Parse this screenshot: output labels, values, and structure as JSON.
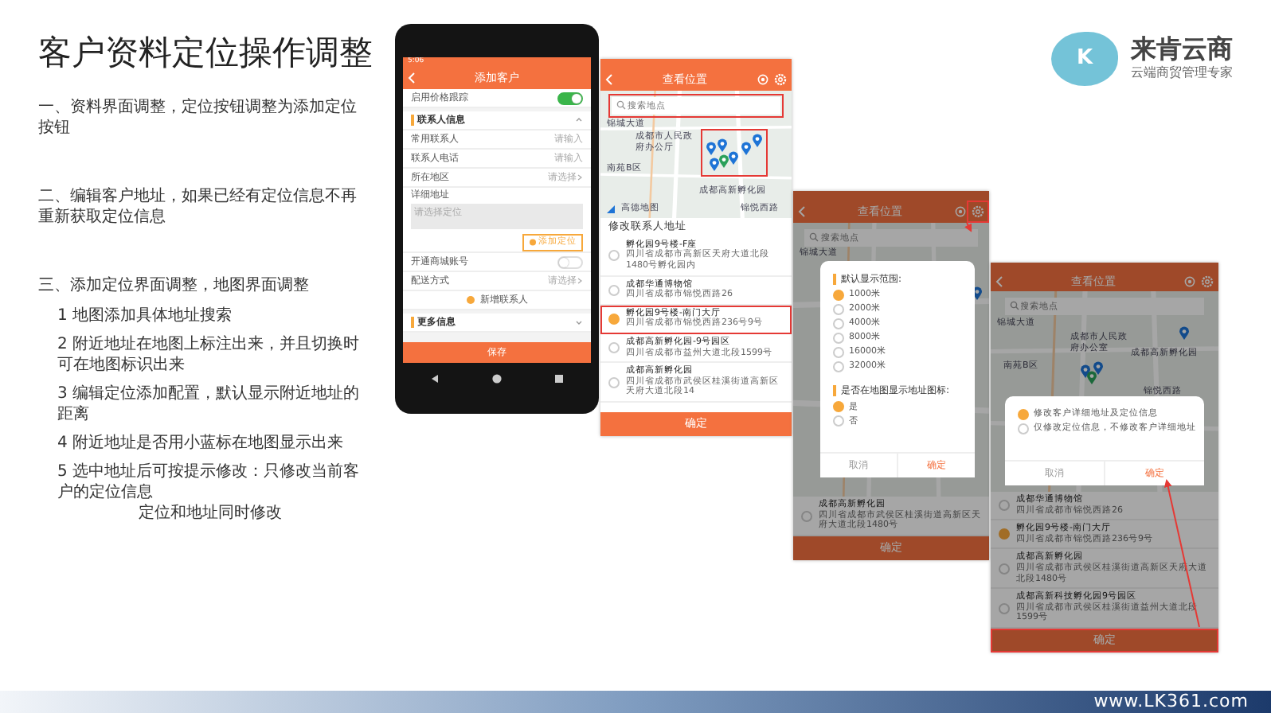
{
  "slide_title": "客户资料定位操作调整",
  "logo": {
    "mark": "K",
    "name": "来肯云商",
    "tagline": "云端商贸管理专家"
  },
  "points": [
    {
      "text": "一、资料界面调整，定位按钮调整为添加定位按钮"
    },
    {
      "text": "二、编辑客户地址，如果已经有定位信息不再重新获取定位信息"
    },
    {
      "text": "三、添加定位界面调整，地图界面调整",
      "children": [
        {
          "lines": [
            "1 地图添加具体地址搜索"
          ]
        },
        {
          "lines": [
            "2 附近地址在地图上标注出来，并且切换时可在地图标识出来"
          ]
        },
        {
          "lines": [
            "3 编辑定位添加配置，默认显示附近地址的距离"
          ]
        },
        {
          "lines": [
            "4 附近地址是否用小蓝标在地图显示出来"
          ]
        },
        {
          "lines": [
            "5 选中地址后可按提示修改：只修改当前客户的定位信息",
            "定位和地址同时修改"
          ]
        }
      ]
    }
  ],
  "screens": [
    {
      "kind": "add_customer",
      "status_time": "5:06",
      "title": "添加客户",
      "rows": [
        {
          "kind": "toggle",
          "label": "启用价格跟踪",
          "on": true
        },
        {
          "kind": "section",
          "label": "联系人信息",
          "expanded": true
        },
        {
          "kind": "field",
          "label": "常用联系人",
          "placeholder": "请输入"
        },
        {
          "kind": "field",
          "label": "联系人电话",
          "placeholder": "请输入"
        },
        {
          "kind": "select",
          "label": "所在地区",
          "placeholder": "请选择"
        },
        {
          "kind": "textarea",
          "label": "详细地址",
          "placeholder": "请选择定位"
        },
        {
          "kind": "action",
          "label": "添加定位"
        },
        {
          "kind": "toggle",
          "label": "开通商城账号",
          "on": false
        },
        {
          "kind": "select",
          "label": "配送方式",
          "placeholder": "请选择"
        },
        {
          "kind": "link",
          "label": "新增联系人"
        },
        {
          "kind": "section",
          "label": "更多信息",
          "expanded": false
        }
      ],
      "save": "保存"
    },
    {
      "kind": "map",
      "title": "查看位置",
      "search_placeholder": "搜索地点",
      "map_labels": [
        "锦城大道",
        "成都市人民政府办公厅",
        "南苑B区",
        "成都高新孵化园",
        "锦悦西路"
      ],
      "map_brand": "高德地图",
      "list_title": "修改联系人地址",
      "addresses": [
        {
          "name": "孵化园9号楼-F座",
          "address": "四川省成都市高新区天府大道北段1480号孵化园内",
          "selected": false
        },
        {
          "name": "成都华通博物馆",
          "address": "四川省成都市锦悦西路26",
          "selected": false
        },
        {
          "name": "孵化园9号楼-南门大厅",
          "address": "四川省成都市锦悦西路236号9号",
          "selected": true
        },
        {
          "name": "成都高新孵化园-9号园区",
          "address": "四川省成都市益州大道北段1599号",
          "selected": false
        },
        {
          "name": "成都高新孵化园",
          "address": "四川省成都市武侯区桂溪街道高新区天府大道北段14",
          "selected": false
        }
      ],
      "confirm": "确定"
    },
    {
      "kind": "map",
      "title": "查看位置",
      "search_placeholder": "搜索地点",
      "map_labels": [
        "锦城大道"
      ],
      "addresses": [
        {
          "name": "成都高新孵化园",
          "address": "四川省成都市武侯区桂溪街道高新区天府大道北段1480号",
          "selected": false
        }
      ],
      "confirm": "确定",
      "dialog": {
        "groups": [
          {
            "title": "默认显示范围:",
            "options": [
              {
                "label": "1000米",
                "selected": true
              },
              {
                "label": "2000米",
                "selected": false
              },
              {
                "label": "4000米",
                "selected": false
              },
              {
                "label": "8000米",
                "selected": false
              },
              {
                "label": "16000米",
                "selected": false
              },
              {
                "label": "32000米",
                "selected": false
              }
            ]
          },
          {
            "title": "是否在地图显示地址图标:",
            "options": [
              {
                "label": "是",
                "selected": true
              },
              {
                "label": "否",
                "selected": false
              }
            ]
          }
        ],
        "cancel": "取消",
        "ok": "确定"
      }
    },
    {
      "kind": "map",
      "title": "查看位置",
      "search_placeholder": "搜索地点",
      "map_labels": [
        "锦城大道",
        "成都市人民政府办公室",
        "南苑B区",
        "成都高新孵化园",
        "锦悦西路"
      ],
      "addresses": [
        {
          "name": "成都华通博物馆",
          "address": "四川省成都市锦悦西路26",
          "selected": false
        },
        {
          "name": "孵化园9号楼-南门大厅",
          "address": "四川省成都市锦悦西路236号9号",
          "selected": true
        },
        {
          "name": "成都高新孵化园",
          "address": "四川省成都市武侯区桂溪街道高新区天府大道北段1480号",
          "selected": false
        },
        {
          "name": "成都高新科技孵化园9号园区",
          "address": "四川省成都市武侯区桂溪街道益州大道北段1599号",
          "selected": false
        }
      ],
      "confirm": "确定",
      "dialog": {
        "groups": [
          {
            "options": [
              {
                "label": "修改客户详细地址及定位信息",
                "selected": true
              },
              {
                "label": "仅修改定位信息，不修改客户详细地址",
                "selected": false
              }
            ]
          }
        ],
        "cancel": "取消",
        "ok": "确定"
      }
    }
  ],
  "footer": {
    "url": "www.LK361.com"
  }
}
